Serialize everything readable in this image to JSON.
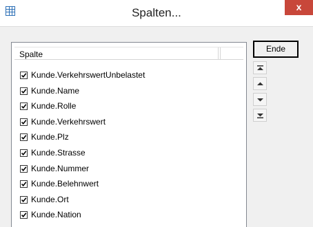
{
  "window": {
    "title": "Spalten...",
    "close_label": "x"
  },
  "list": {
    "column_header": "Spalte",
    "items": [
      {
        "label": "Kunde.VerkehrswertUnbelastet",
        "checked": true
      },
      {
        "label": "Kunde.Name",
        "checked": true
      },
      {
        "label": "Kunde.Rolle",
        "checked": true
      },
      {
        "label": "Kunde.Verkehrswert",
        "checked": true
      },
      {
        "label": "Kunde.Plz",
        "checked": true
      },
      {
        "label": "Kunde.Strasse",
        "checked": true
      },
      {
        "label": "Kunde.Nummer",
        "checked": true
      },
      {
        "label": "Kunde.Belehnwert",
        "checked": true
      },
      {
        "label": "Kunde.Ort",
        "checked": true
      },
      {
        "label": "Kunde.Nation",
        "checked": true
      }
    ]
  },
  "buttons": {
    "ende_label": "Ende",
    "move_top_icon": "move-to-top-icon",
    "move_up_icon": "move-up-icon",
    "move_down_icon": "move-down-icon",
    "move_bottom_icon": "move-to-bottom-icon"
  },
  "colors": {
    "close_button": "#c8473a",
    "icon_accent": "#2c6fb6"
  }
}
